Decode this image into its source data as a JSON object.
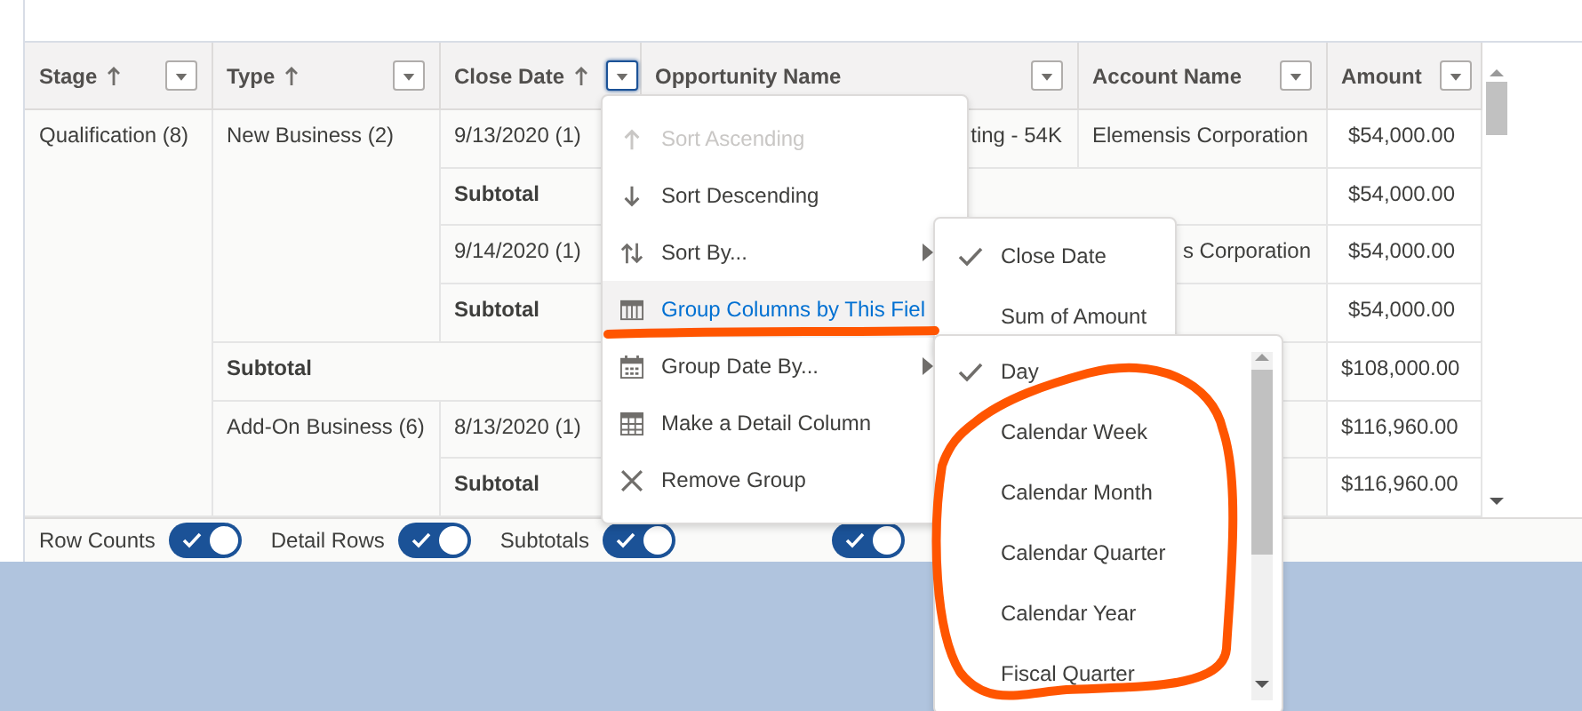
{
  "table": {
    "columns": [
      {
        "label": "Stage",
        "sorted": true,
        "menu_open": false
      },
      {
        "label": "Type",
        "sorted": true,
        "menu_open": false
      },
      {
        "label": "Close Date",
        "sorted": true,
        "menu_open": true
      },
      {
        "label": "Opportunity Name",
        "sorted": false,
        "menu_open": false
      },
      {
        "label": "Account Name",
        "sorted": false,
        "menu_open": false
      },
      {
        "label": "Amount",
        "sorted": false,
        "menu_open": false
      }
    ],
    "groups": [
      {
        "label": "Qualification (8)",
        "types": [
          {
            "label": "New Business (2)",
            "dates": [
              {
                "label": "9/13/2020 (1)",
                "details": [
                  {
                    "opportunity": "ting - 54K",
                    "account": "Elemensis Corporation",
                    "account_cut": false,
                    "amount": "$54,000.00"
                  }
                ],
                "subtotal": {
                  "label": "Subtotal",
                  "amount": "$54,000.00"
                }
              },
              {
                "label": "9/14/2020 (1)",
                "details": [
                  {
                    "account": "s Corporation",
                    "account_cut": true,
                    "amount": "$54,000.00"
                  }
                ],
                "subtotal": {
                  "label": "Subtotal",
                  "amount": "$54,000.00"
                }
              }
            ],
            "subtotal": {
              "label": "Subtotal",
              "amount": "$108,000.00"
            }
          },
          {
            "label": "Add-On Business (6)",
            "dates": [
              {
                "label": "8/13/2020 (1)",
                "details": [
                  {
                    "amount": "$116,960.00"
                  }
                ],
                "subtotal": {
                  "label": "Subtotal",
                  "amount": "$116,960.00"
                }
              }
            ]
          }
        ]
      }
    ]
  },
  "footer_toggles": [
    {
      "label": "Row Counts",
      "on": true
    },
    {
      "label": "Detail Rows",
      "on": true
    },
    {
      "label": "Subtotals",
      "on": true
    },
    {
      "on": true
    }
  ],
  "column_menu": {
    "items": [
      {
        "label": "Sort Ascending",
        "disabled": true,
        "selected": false,
        "has_submenu": false
      },
      {
        "label": "Sort Descending",
        "disabled": false,
        "selected": false,
        "has_submenu": false
      },
      {
        "label": "Sort By...",
        "disabled": false,
        "selected": false,
        "has_submenu": true
      },
      {
        "label": "Group Columns by This Fiel",
        "disabled": false,
        "selected": true,
        "has_submenu": false
      },
      {
        "label": "Group Date By...",
        "disabled": false,
        "selected": false,
        "has_submenu": true
      },
      {
        "label": "Make a Detail Column",
        "disabled": false,
        "selected": false,
        "has_submenu": false
      },
      {
        "label": "Remove Group",
        "disabled": false,
        "selected": false,
        "has_submenu": false
      }
    ]
  },
  "sort_by_menu": {
    "items": [
      {
        "label": "Close Date",
        "checked": true
      },
      {
        "label": "Sum of Amount",
        "checked": false
      }
    ]
  },
  "group_date_menu": {
    "items": [
      {
        "label": "Day",
        "checked": true
      },
      {
        "label": "Calendar Week",
        "checked": false
      },
      {
        "label": "Calendar Month",
        "checked": false
      },
      {
        "label": "Calendar Quarter",
        "checked": false
      },
      {
        "label": "Calendar Year",
        "checked": false
      },
      {
        "label": "Fiscal Quarter",
        "checked": false
      }
    ]
  },
  "annotations": {
    "underline": {
      "color": "#ff5500"
    },
    "circle": {
      "color": "#ff5500"
    }
  }
}
